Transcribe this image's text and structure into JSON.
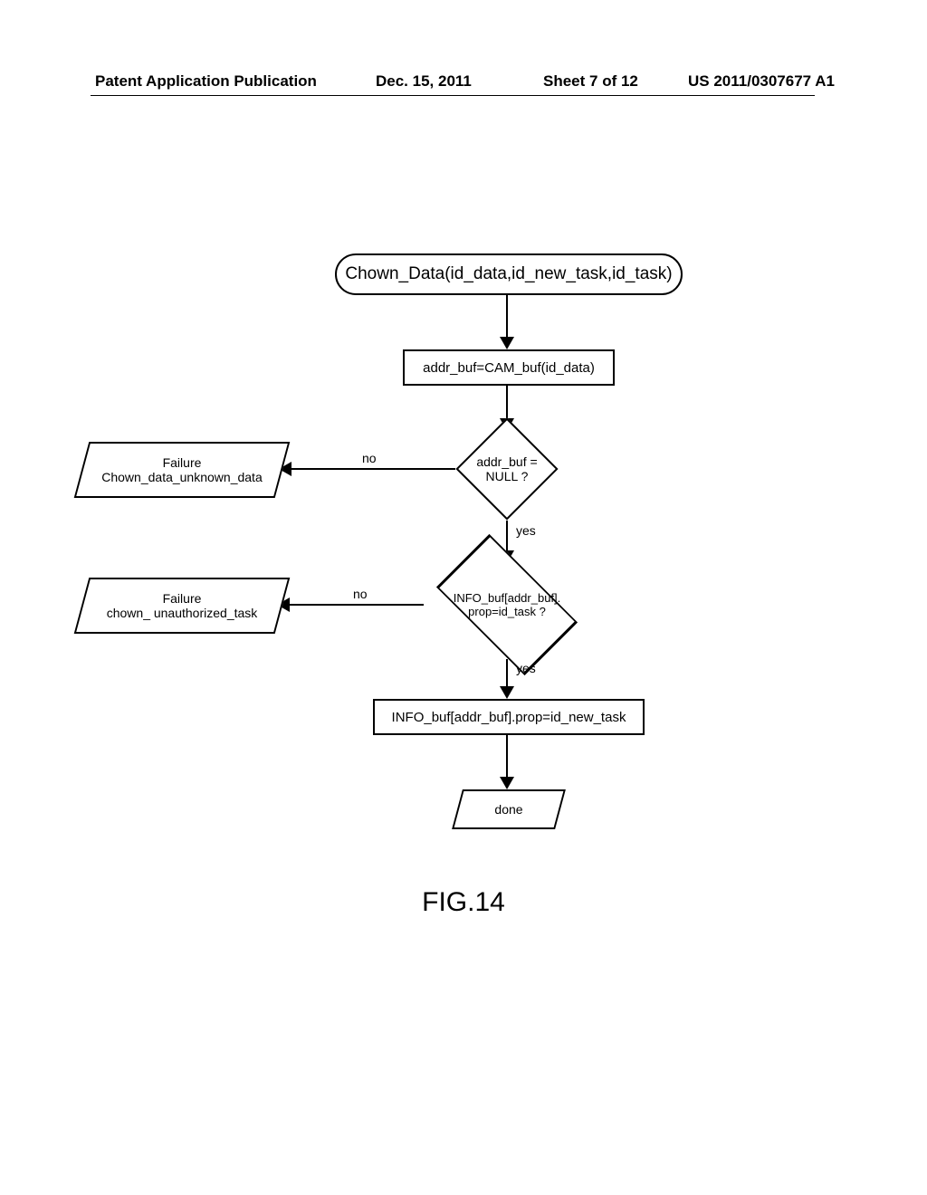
{
  "header": {
    "left": "Patent Application Publication",
    "date": "Dec. 15, 2011",
    "sheet": "Sheet 7 of 12",
    "pubnum": "US 2011/0307677 A1"
  },
  "flow": {
    "start": "Chown_Data(id_data,id_new_task,id_task)",
    "p1": "addr_buf=CAM_buf(id_data)",
    "d1_line1": "addr_buf =",
    "d1_line2": "NULL ?",
    "fail1_l1": "Failure",
    "fail1_l2": "Chown_data_unknown_data",
    "d2_line1": "INFO_buf[addr_buf].",
    "d2_line2": "prop=id_task ?",
    "fail2_l1": "Failure",
    "fail2_l2": "chown_ unauthorized_task",
    "p2": "INFO_buf[addr_buf].prop=id_new_task",
    "done": "done",
    "no": "no",
    "yes": "yes"
  },
  "caption": "FIG.14",
  "chart_data": {
    "type": "flowchart",
    "title": "FIG.14",
    "nodes": [
      {
        "id": "start",
        "shape": "terminator",
        "text": "Chown_Data(id_data,id_new_task,id_task)"
      },
      {
        "id": "p1",
        "shape": "process",
        "text": "addr_buf=CAM_buf(id_data)"
      },
      {
        "id": "d1",
        "shape": "decision",
        "text": "addr_buf = NULL ?"
      },
      {
        "id": "f1",
        "shape": "io",
        "text": "Failure Chown_data_unknown_data"
      },
      {
        "id": "d2",
        "shape": "decision",
        "text": "INFO_buf[addr_buf].prop=id_task ?"
      },
      {
        "id": "f2",
        "shape": "io",
        "text": "Failure chown_ unauthorized_task"
      },
      {
        "id": "p2",
        "shape": "process",
        "text": "INFO_buf[addr_buf].prop=id_new_task"
      },
      {
        "id": "done",
        "shape": "io",
        "text": "done"
      }
    ],
    "edges": [
      {
        "from": "start",
        "to": "p1"
      },
      {
        "from": "p1",
        "to": "d1"
      },
      {
        "from": "d1",
        "to": "f1",
        "label": "no"
      },
      {
        "from": "d1",
        "to": "d2",
        "label": "yes"
      },
      {
        "from": "d2",
        "to": "f2",
        "label": "no"
      },
      {
        "from": "d2",
        "to": "p2",
        "label": "yes"
      },
      {
        "from": "p2",
        "to": "done"
      }
    ]
  }
}
